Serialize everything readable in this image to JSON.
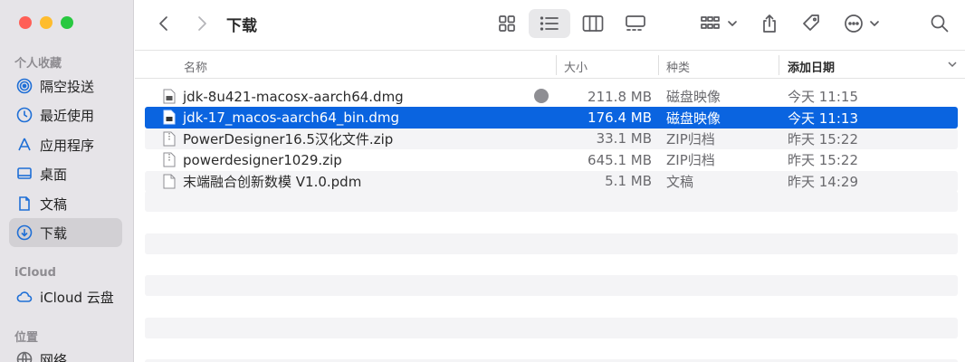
{
  "window": {
    "title": "下载"
  },
  "sidebar": {
    "sections": [
      {
        "title": "个人收藏",
        "items": [
          {
            "label": "隔空投送",
            "icon": "airdrop-icon"
          },
          {
            "label": "最近使用",
            "icon": "clock-icon"
          },
          {
            "label": "应用程序",
            "icon": "applications-icon"
          },
          {
            "label": "桌面",
            "icon": "desktop-icon"
          },
          {
            "label": "文稿",
            "icon": "document-icon"
          },
          {
            "label": "下载",
            "icon": "download-icon",
            "selected": true
          }
        ]
      },
      {
        "title": "iCloud",
        "items": [
          {
            "label": "iCloud 云盘",
            "icon": "cloud-icon"
          }
        ]
      },
      {
        "title": "位置",
        "items": [
          {
            "label": "网络",
            "icon": "network-icon"
          }
        ]
      }
    ]
  },
  "columns": {
    "name": "名称",
    "size": "大小",
    "kind": "种类",
    "date": "添加日期"
  },
  "files": [
    {
      "name": "jdk-8u421-macosx-aarch64.dmg",
      "size": "211.8 MB",
      "kind": "磁盘映像",
      "date": "今天 11:15",
      "icon": "dmg-file-icon",
      "status": "download-dot"
    },
    {
      "name": "jdk-17_macos-aarch64_bin.dmg",
      "size": "176.4 MB",
      "kind": "磁盘映像",
      "date": "今天 11:13",
      "icon": "dmg-file-icon",
      "selected": true
    },
    {
      "name": "PowerDesigner16.5汉化文件.zip",
      "size": "33.1 MB",
      "kind": "ZIP归档",
      "date": "昨天 15:22",
      "icon": "zip-file-icon"
    },
    {
      "name": "powerdesigner1029.zip",
      "size": "645.1 MB",
      "kind": "ZIP归档",
      "date": "昨天 15:22",
      "icon": "zip-file-icon"
    },
    {
      "name": "末端融合创新数模 V1.0.pdm",
      "size": "5.1 MB",
      "kind": "文稿",
      "date": "昨天 14:29",
      "icon": "generic-file-icon"
    }
  ],
  "colors": {
    "selection": "#0a64e0",
    "sidebar": "#e6e4e8"
  }
}
